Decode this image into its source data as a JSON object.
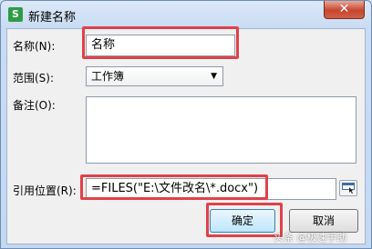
{
  "window": {
    "title": "新建名称",
    "app_icon_text": "S",
    "close_symbol": "✕"
  },
  "form": {
    "name_label": "名称(N):",
    "name_value": "名称",
    "scope_label": "范围(S):",
    "scope_value": "工作簿",
    "comment_label": "备注(O):",
    "comment_value": "",
    "refers_to_label": "引用位置(R):",
    "refers_to_value": "=FILES(\"E:\\文件改名\\*.docx\")"
  },
  "buttons": {
    "ok_label": "确定",
    "cancel_label": "取消"
  },
  "watermark": "头条 @极速手助",
  "colors": {
    "highlight": "#e0414a",
    "app_icon": "#2e9b46",
    "close_button": "#c7462e"
  },
  "icons": {
    "app": "spreadsheet-app-icon",
    "close": "close-icon",
    "dropdown": "chevron-down-icon",
    "range_select": "range-select-icon"
  }
}
